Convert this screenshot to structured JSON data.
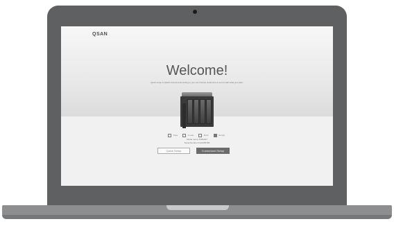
{
  "screen": {
    "logo": "QSAN",
    "title": "Welcome!",
    "subtitle": "Quick setup is QSAN recommend setting or you can choose customize to set up with what you want.",
    "legend": [
      {
        "label": "Free"
      },
      {
        "label": "In use"
      },
      {
        "label": "Error"
      },
      {
        "label": "Empty"
      }
    ],
    "model": "Model name XN5004T",
    "serial": "Serial Number 0123456789",
    "buttons": {
      "quick_setup": "Quick Setup",
      "customized_setup": "Customized Setup"
    }
  }
}
